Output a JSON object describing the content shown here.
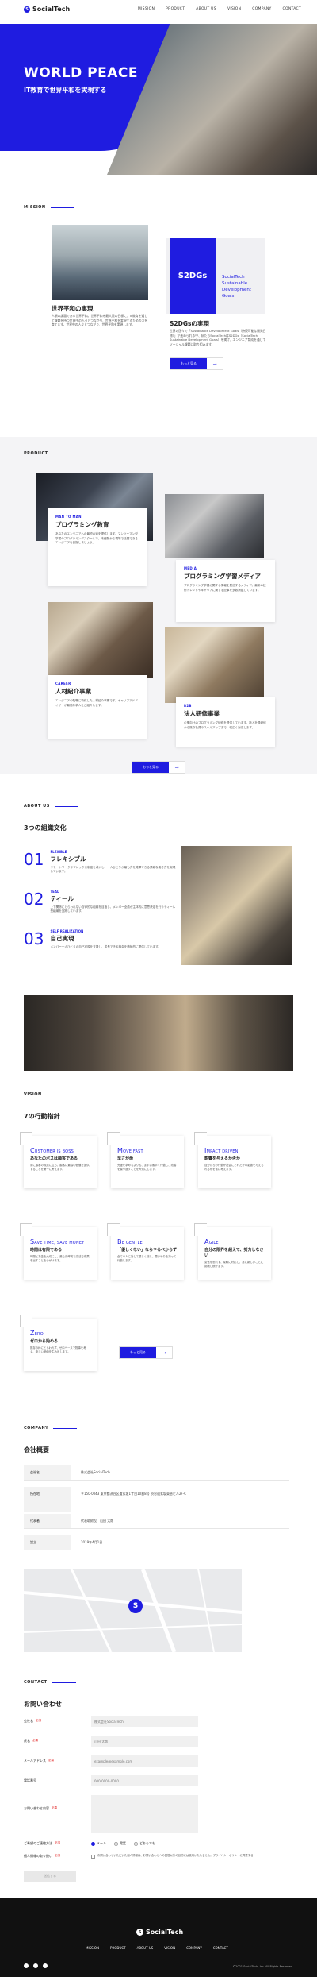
{
  "header": {
    "logo": "SocialTech",
    "logo_mark": "S",
    "nav": [
      "MISSION",
      "PRODUCT",
      "ABOUT US",
      "VISION",
      "COMPANY",
      "CONTACT"
    ]
  },
  "hero": {
    "title": "WORLD PEACE",
    "subtitle": "IT教育で世界平和を実現する"
  },
  "mission": {
    "label": "MISSION",
    "card1_title": "世界平和の実現",
    "card1_text": "人類の課題である世界平和。世界平和を最大限の目標に、IT教育を通じて課題を持つ世界中の人々とつながり、世界平和を実現するための力を育てます。世界中の人々とつながり、世界平和を実現します。",
    "card2_box": "S2DGs",
    "card2_box_text": "SocialTech Sustainable Development Goals",
    "card2_title": "S2DGsの実現",
    "card2_text": "世界の国々で「Sustainable Development Goals（持続可能な開発目標）」が進められる中、私たちSocialTechはS2DGs（SocialTech Sustainable Development Goals）を掲げ、エンジニア育成を通じてソーシャル課題に取り組みます。",
    "more": "もっと見る",
    "arrow": "→"
  },
  "product": {
    "label": "PRODUCT",
    "items": [
      {
        "tag": "MAN TO MAN",
        "title": "プログラミング教育",
        "text": "あなたのエンジニアへの最短の道を提供します。マンツーマン型学習のプログラミングスクールで、未経験から現場で活躍できるエンジニアを目指しましょう。"
      },
      {
        "tag": "MEDIA",
        "title": "プログラミング学習メディア",
        "text": "プログラミング学習に関する情報を発信するメディア。最新の技術トレンドやキャリアに関する記事を多数掲載しています。"
      },
      {
        "tag": "CAREER",
        "title": "人材紹介事業",
        "text": "エンジニアの転職に特化した人材紹介事業です。キャリアアドバイザーが最適な求人をご紹介します。"
      },
      {
        "tag": "B2B",
        "title": "法人研修事業",
        "text": "企業向けのプログラミング研修を提供しています。新入社員研修から既存社員のスキルアップまで、幅広く対応します。"
      }
    ],
    "more": "もっと見る"
  },
  "about": {
    "label": "ABOUT US",
    "heading": "3つの組織文化",
    "items": [
      {
        "num": "01",
        "tag": "FLEXIBLE",
        "title": "フレキシブル",
        "text": "リモートワークやフレックス制度を導入し、一人ひとりが最も力を発揮できる柔軟な働き方を実現しています。"
      },
      {
        "num": "02",
        "tag": "TEAL",
        "title": "ティール",
        "text": "上下関係にとらわれない自律的な組織を目指し、メンバー全員が主体的に意思決定を行うティール型組織を実践しています。"
      },
      {
        "num": "03",
        "tag": "SELF REALIZATION",
        "title": "自己実現",
        "text": "メンバー一人ひとりの自己実現を支援し、成長できる機会を積極的に提供しています。"
      }
    ]
  },
  "vision": {
    "label": "VISION",
    "heading": "7の行動指針",
    "items": [
      {
        "first": "C",
        "rest": "USTOMER IS BOSS",
        "jp": "あなたのボスは顧客である",
        "text": "常に顧客の視点に立ち、顧客に最高の価値を提供することを第一に考えます。"
      },
      {
        "first": "M",
        "rest": "OVE FAST",
        "jp": "早さが命",
        "text": "完璧を求めるよりも、まずは素早く行動し、改善を繰り返すことを大切にします。"
      },
      {
        "first": "I",
        "rest": "MPACT DRIVEN",
        "jp": "影響を与えるか否か",
        "text": "自分たちの行動が社会にどれだけの影響を与えられるかを常に考えます。"
      },
      {
        "first": "S",
        "rest": "AVE TIME, SAVE MONEY",
        "jp": "時間は有限である",
        "text": "時間とお金を大切にし、最も効率的な方法で成果を出すことを心がけます。"
      },
      {
        "first": "B",
        "rest": "E GENTLE",
        "jp": "「優しくない」ならやるべからず",
        "text": "全ての人に対して優しく接し、思いやりを持って行動します。"
      },
      {
        "first": "A",
        "rest": "GILE",
        "jp": "自分の限界を超えて、努力しなさい",
        "text": "変化を恐れず、柔軟に対応し、常に新しいことに挑戦し続けます。"
      },
      {
        "first": "Z",
        "rest": "ERO",
        "jp": "ゼロから始める",
        "text": "既存の枠にとらわれず、ゼロベースで物事を考え、新しい価値を生み出します。"
      }
    ],
    "more": "もっと見る"
  },
  "company": {
    "label": "COMPANY",
    "heading": "会社概要",
    "rows": [
      {
        "k": "会社名",
        "v": "株式会社SocialTech"
      },
      {
        "k": "所在地",
        "v": "〒150-0043 東京都渋谷区道玄坂1丁目10番8号 渋谷道玄坂東急ビル2F-C"
      },
      {
        "k": "代表者",
        "v": "代表取締役　山田 太郎"
      },
      {
        "k": "設立",
        "v": "2019年4月1日"
      }
    ]
  },
  "contact": {
    "label": "CONTACT",
    "heading": "お問い合わせ",
    "fields": [
      {
        "label": "会社名",
        "req": "必須",
        "placeholder": "株式会社SocialTech"
      },
      {
        "label": "氏名",
        "req": "必須",
        "placeholder": "山田 太郎"
      },
      {
        "label": "メールアドレス",
        "req": "必須",
        "placeholder": "example@example.com"
      },
      {
        "label": "電話番号",
        "req": "",
        "placeholder": "000-0000-0000"
      },
      {
        "label": "お問い合わせ内容",
        "req": "必須",
        "placeholder": ""
      }
    ],
    "radio_label": "ご希望のご連絡方法",
    "radio_options": [
      "メール",
      "電話",
      "どちらでも"
    ],
    "privacy_label": "個人情報の取り扱い",
    "privacy_text": "お問い合わせいただいた個人情報は、お問い合わせへの回答以外の目的には使用いたしません。プライバシーポリシーに同意する",
    "submit": "送信する"
  },
  "footer": {
    "logo": "SocialTech",
    "nav": [
      "MISSION",
      "PRODUCT",
      "ABOUT US",
      "VISION",
      "COMPANY",
      "CONTACT"
    ],
    "copyright": "©2021 SocialTech, Inc. All Rights Reserved."
  }
}
